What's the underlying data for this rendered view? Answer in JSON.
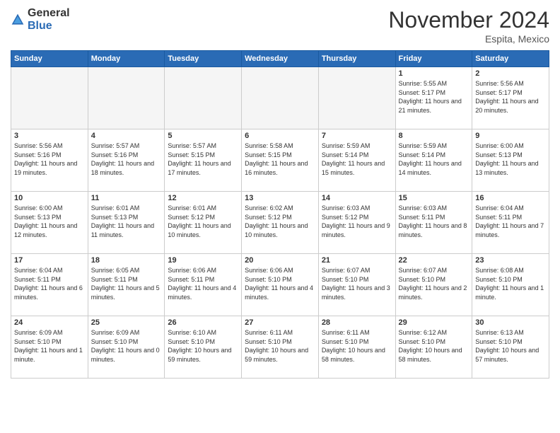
{
  "logo": {
    "general": "General",
    "blue": "Blue"
  },
  "header": {
    "month": "November 2024",
    "location": "Espita, Mexico"
  },
  "weekdays": [
    "Sunday",
    "Monday",
    "Tuesday",
    "Wednesday",
    "Thursday",
    "Friday",
    "Saturday"
  ],
  "weeks": [
    [
      {
        "day": "",
        "empty": true
      },
      {
        "day": "",
        "empty": true
      },
      {
        "day": "",
        "empty": true
      },
      {
        "day": "",
        "empty": true
      },
      {
        "day": "",
        "empty": true
      },
      {
        "day": "1",
        "sunrise": "5:55 AM",
        "sunset": "5:17 PM",
        "daylight": "11 hours and 21 minutes."
      },
      {
        "day": "2",
        "sunrise": "5:56 AM",
        "sunset": "5:17 PM",
        "daylight": "11 hours and 20 minutes."
      }
    ],
    [
      {
        "day": "3",
        "sunrise": "5:56 AM",
        "sunset": "5:16 PM",
        "daylight": "11 hours and 19 minutes."
      },
      {
        "day": "4",
        "sunrise": "5:57 AM",
        "sunset": "5:16 PM",
        "daylight": "11 hours and 18 minutes."
      },
      {
        "day": "5",
        "sunrise": "5:57 AM",
        "sunset": "5:15 PM",
        "daylight": "11 hours and 17 minutes."
      },
      {
        "day": "6",
        "sunrise": "5:58 AM",
        "sunset": "5:15 PM",
        "daylight": "11 hours and 16 minutes."
      },
      {
        "day": "7",
        "sunrise": "5:59 AM",
        "sunset": "5:14 PM",
        "daylight": "11 hours and 15 minutes."
      },
      {
        "day": "8",
        "sunrise": "5:59 AM",
        "sunset": "5:14 PM",
        "daylight": "11 hours and 14 minutes."
      },
      {
        "day": "9",
        "sunrise": "6:00 AM",
        "sunset": "5:13 PM",
        "daylight": "11 hours and 13 minutes."
      }
    ],
    [
      {
        "day": "10",
        "sunrise": "6:00 AM",
        "sunset": "5:13 PM",
        "daylight": "11 hours and 12 minutes."
      },
      {
        "day": "11",
        "sunrise": "6:01 AM",
        "sunset": "5:13 PM",
        "daylight": "11 hours and 11 minutes."
      },
      {
        "day": "12",
        "sunrise": "6:01 AM",
        "sunset": "5:12 PM",
        "daylight": "11 hours and 10 minutes."
      },
      {
        "day": "13",
        "sunrise": "6:02 AM",
        "sunset": "5:12 PM",
        "daylight": "11 hours and 10 minutes."
      },
      {
        "day": "14",
        "sunrise": "6:03 AM",
        "sunset": "5:12 PM",
        "daylight": "11 hours and 9 minutes."
      },
      {
        "day": "15",
        "sunrise": "6:03 AM",
        "sunset": "5:11 PM",
        "daylight": "11 hours and 8 minutes."
      },
      {
        "day": "16",
        "sunrise": "6:04 AM",
        "sunset": "5:11 PM",
        "daylight": "11 hours and 7 minutes."
      }
    ],
    [
      {
        "day": "17",
        "sunrise": "6:04 AM",
        "sunset": "5:11 PM",
        "daylight": "11 hours and 6 minutes."
      },
      {
        "day": "18",
        "sunrise": "6:05 AM",
        "sunset": "5:11 PM",
        "daylight": "11 hours and 5 minutes."
      },
      {
        "day": "19",
        "sunrise": "6:06 AM",
        "sunset": "5:11 PM",
        "daylight": "11 hours and 4 minutes."
      },
      {
        "day": "20",
        "sunrise": "6:06 AM",
        "sunset": "5:10 PM",
        "daylight": "11 hours and 4 minutes."
      },
      {
        "day": "21",
        "sunrise": "6:07 AM",
        "sunset": "5:10 PM",
        "daylight": "11 hours and 3 minutes."
      },
      {
        "day": "22",
        "sunrise": "6:07 AM",
        "sunset": "5:10 PM",
        "daylight": "11 hours and 2 minutes."
      },
      {
        "day": "23",
        "sunrise": "6:08 AM",
        "sunset": "5:10 PM",
        "daylight": "11 hours and 1 minute."
      }
    ],
    [
      {
        "day": "24",
        "sunrise": "6:09 AM",
        "sunset": "5:10 PM",
        "daylight": "11 hours and 1 minute."
      },
      {
        "day": "25",
        "sunrise": "6:09 AM",
        "sunset": "5:10 PM",
        "daylight": "11 hours and 0 minutes."
      },
      {
        "day": "26",
        "sunrise": "6:10 AM",
        "sunset": "5:10 PM",
        "daylight": "10 hours and 59 minutes."
      },
      {
        "day": "27",
        "sunrise": "6:11 AM",
        "sunset": "5:10 PM",
        "daylight": "10 hours and 59 minutes."
      },
      {
        "day": "28",
        "sunrise": "6:11 AM",
        "sunset": "5:10 PM",
        "daylight": "10 hours and 58 minutes."
      },
      {
        "day": "29",
        "sunrise": "6:12 AM",
        "sunset": "5:10 PM",
        "daylight": "10 hours and 58 minutes."
      },
      {
        "day": "30",
        "sunrise": "6:13 AM",
        "sunset": "5:10 PM",
        "daylight": "10 hours and 57 minutes."
      }
    ]
  ]
}
